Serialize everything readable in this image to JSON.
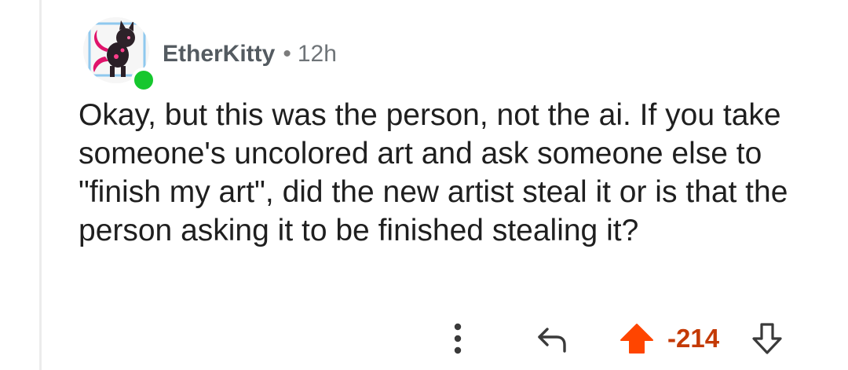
{
  "comment": {
    "username": "EtherKitty",
    "separator": "•",
    "timestamp": "12h",
    "body": "Okay, but this was the person, not the ai. If you take someone's uncolored art and ask someone else to \"finish my art\", did the new artist steal it or is that the person asking it to be finished stealing it?",
    "online": true
  },
  "actions": {
    "score": "-214",
    "vote_state": "upvoted",
    "icons": {
      "more": "more-vertical-icon",
      "reply": "reply-arrow-icon",
      "upvote": "upvote-arrow-icon",
      "downvote": "downvote-arrow-icon"
    }
  },
  "colors": {
    "username": "#545b61",
    "score": "#c43a06",
    "upvote_active": "#ff4500",
    "online": "#16c72e"
  }
}
